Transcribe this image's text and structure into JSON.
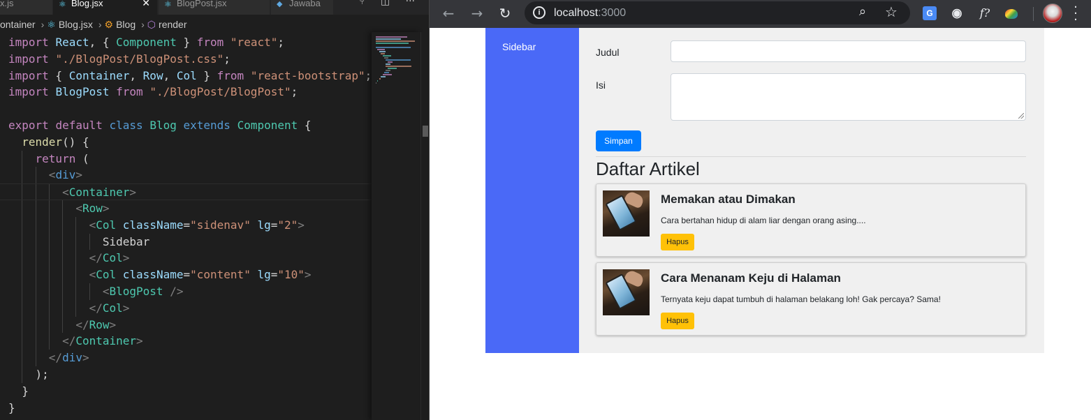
{
  "editor": {
    "tabs": [
      {
        "label": "x.js",
        "active": false
      },
      {
        "label": "Blog.jsx",
        "active": true
      },
      {
        "label": "BlogPost.jsx",
        "active": false
      },
      {
        "label": "Jawaba",
        "active": false
      }
    ],
    "breadcrumb": {
      "folder": "ontainer",
      "file": "Blog.jsx",
      "class": "Blog",
      "method": "render"
    },
    "code_lines": [
      "import React, { Component } from \"react\";",
      "import \"./BlogPost/BlogPost.css\";",
      "import { Container, Row, Col } from \"react-bootstrap\";",
      "import BlogPost from \"./BlogPost/BlogPost\";",
      "",
      "export default class Blog extends Component {",
      "  render() {",
      "    return (",
      "      <div>",
      "        <Container>",
      "          <Row>",
      "            <Col className=\"sidenav\" lg=\"2\">",
      "              Sidebar",
      "            </Col>",
      "            <Col className=\"content\" lg=\"10\">",
      "              <BlogPost />",
      "            </Col>",
      "          </Row>",
      "        </Container>",
      "      </div>",
      "    );",
      "  }",
      "}"
    ]
  },
  "browser": {
    "url_host": "localhost",
    "url_port": ":3000",
    "extensions": [
      "google-translate-icon",
      "camera-icon",
      "fx-icon",
      "color-picker-icon"
    ]
  },
  "app": {
    "sidebar_label": "Sidebar",
    "form": {
      "title_label": "Judul",
      "title_value": "",
      "body_label": "Isi",
      "body_value": "",
      "submit_label": "Simpan"
    },
    "section_title": "Daftar Artikel",
    "articles": [
      {
        "title": "Memakan atau Dimakan",
        "body": "Cara bertahan hidup di alam liar dengan orang asing....",
        "delete_label": "Hapus"
      },
      {
        "title": "Cara Menanam Keju di Halaman",
        "body": "Ternyata keju dapat tumbuh di halaman belakang loh! Gak percaya? Sama!",
        "delete_label": "Hapus"
      }
    ]
  },
  "colors": {
    "sidebar_bg": "#4a69f7",
    "primary_button": "#007bff",
    "warning_button": "#ffc107",
    "editor_bg": "#1e1e1e"
  }
}
